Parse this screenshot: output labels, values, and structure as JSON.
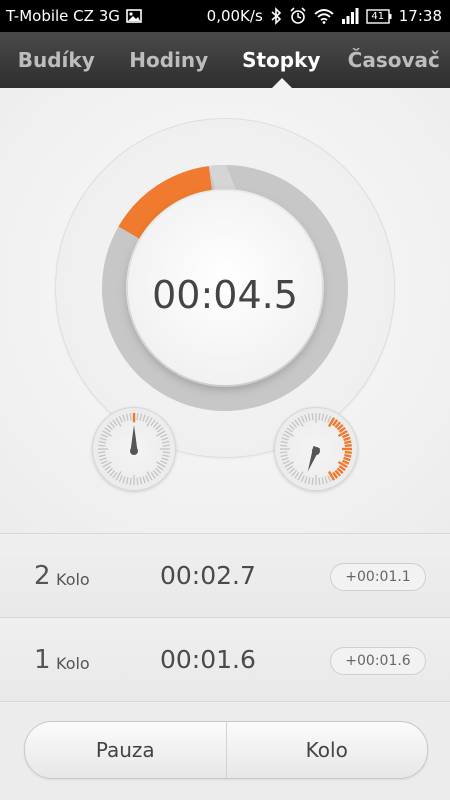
{
  "status_bar": {
    "carrier": "T-Mobile CZ 3G",
    "data_rate": "0,00K/s",
    "battery": "41",
    "time": "17:38"
  },
  "tabs": [
    {
      "label": "Budíky",
      "active": false
    },
    {
      "label": "Hodiny",
      "active": false
    },
    {
      "label": "Stopky",
      "active": true
    },
    {
      "label": "Časovač",
      "active": false
    }
  ],
  "stopwatch": {
    "elapsed": "00:04.5",
    "progress_fraction": 0.075,
    "accent_color": "#f07a2d"
  },
  "subdials": {
    "left_needle_deg": 0,
    "right_needle_deg": 200,
    "right_fill_fraction": 0.42
  },
  "laps": [
    {
      "number": "2",
      "label": "Kolo",
      "time": "00:02.7",
      "delta": "+00:01.1"
    },
    {
      "number": "1",
      "label": "Kolo",
      "time": "00:01.6",
      "delta": "+00:01.6"
    }
  ],
  "buttons": {
    "pause_label": "Pauza",
    "lap_label": "Kolo"
  }
}
